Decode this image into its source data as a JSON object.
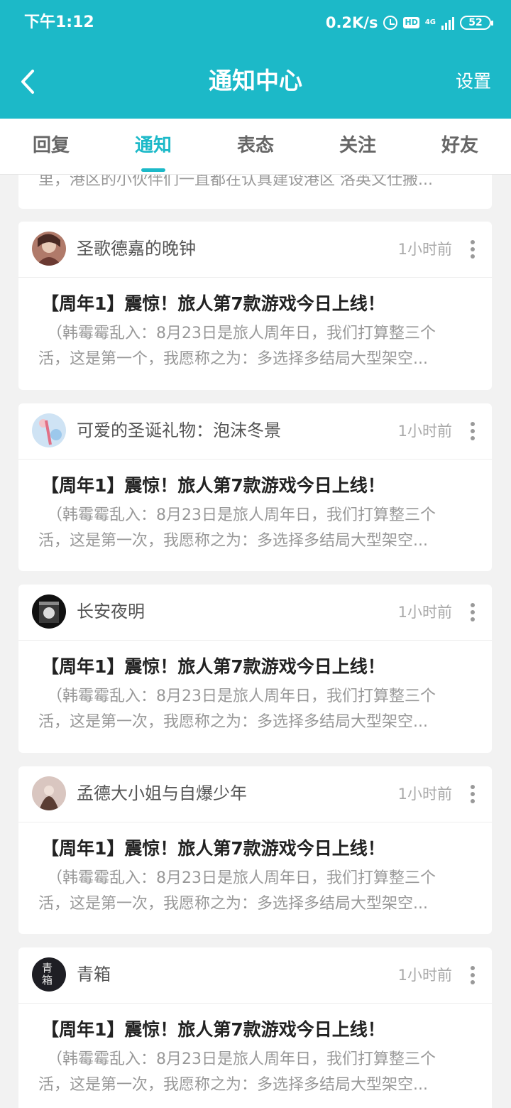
{
  "status_bar": {
    "time": "下午1:12",
    "speed": "0.2K/s",
    "hd": "HD",
    "network": "4G",
    "battery": "52"
  },
  "header": {
    "title": "通知中心",
    "settings": "设置"
  },
  "tabs": [
    {
      "label": "回复",
      "active": false
    },
    {
      "label": "通知",
      "active": true
    },
    {
      "label": "表态",
      "active": false
    },
    {
      "label": "关注",
      "active": false
    },
    {
      "label": "好友",
      "active": false
    }
  ],
  "partial_card": {
    "snippet": "里，港区的小伙伴们一直都在认真建设港区 洛英文仕搬..."
  },
  "notifications": [
    {
      "user": "圣歌德嘉的晚钟",
      "time": "1小时前",
      "title": "【周年1】震惊！旅人第7款游戏今日上线！",
      "line1": "（韩霉霉乱入：8月23日是旅人周年日，我们打算整三个",
      "line2": "活，这是第一个，我愿称之为：多选择多结局大型架空..."
    },
    {
      "user": "可爱的圣诞礼物：泡沫冬景",
      "time": "1小时前",
      "title": "【周年1】震惊！旅人第7款游戏今日上线！",
      "line1": "（韩霉霉乱入：8月23日是旅人周年日，我们打算整三个",
      "line2": "活，这是第一次，我愿称之为：多选择多结局大型架空..."
    },
    {
      "user": "长安夜明",
      "time": "1小时前",
      "title": "【周年1】震惊！旅人第7款游戏今日上线！",
      "line1": "（韩霉霉乱入：8月23日是旅人周年日，我们打算整三个",
      "line2": "活，这是第一次，我愿称之为：多选择多结局大型架空..."
    },
    {
      "user": "孟德大小姐与自爆少年",
      "time": "1小时前",
      "title": "【周年1】震惊！旅人第7款游戏今日上线！",
      "line1": "（韩霉霉乱入：8月23日是旅人周年日，我们打算整三个",
      "line2": "活，这是第一次，我愿称之为：多选择多结局大型架空..."
    },
    {
      "user": "青箱",
      "avatar_text": "青箱",
      "time": "1小时前",
      "title": "【周年1】震惊！旅人第7款游戏今日上线！",
      "line1": "（韩霉霉乱入：8月23日是旅人周年日，我们打算整三个",
      "line2": "活，这是第一次，我愿称之为：多选择多结局大型架空..."
    }
  ],
  "colors": {
    "accent": "#1cb9c8",
    "background": "#f2f2f2"
  }
}
